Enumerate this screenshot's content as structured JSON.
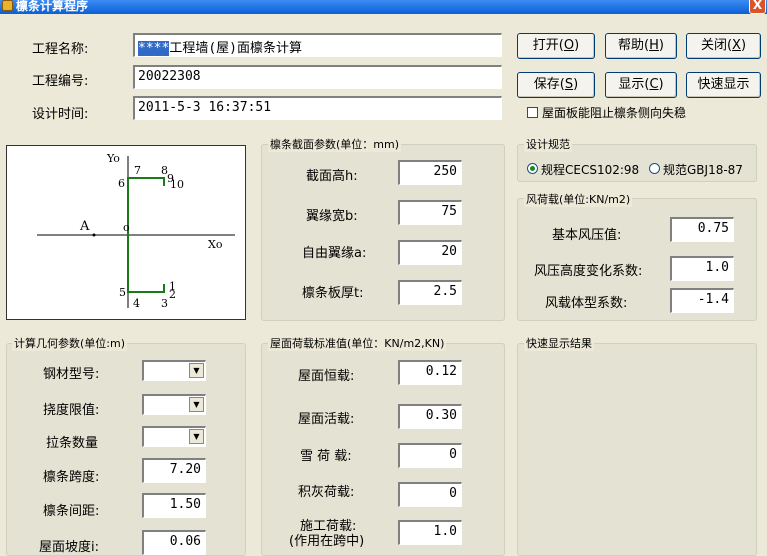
{
  "window": {
    "title": "檩条计算程序",
    "close": "X"
  },
  "project": {
    "name_label": "工程名称:",
    "name_value_selected": "****",
    "name_value_rest": "工程墙(屋)面檩条计算",
    "number_label": "工程编号:",
    "number_value": "20022308",
    "time_label": "设计时间:",
    "time_value": "2011-5-3 16:37:51"
  },
  "buttons": {
    "open": {
      "text": "打开(",
      "key": "O",
      "end": ")"
    },
    "help": {
      "text": "帮助(",
      "key": "H",
      "end": ")"
    },
    "close": {
      "text": "关闭(",
      "key": "X",
      "end": ")"
    },
    "save": {
      "text": "保存(",
      "key": "S",
      "end": ")"
    },
    "show": {
      "text": "显示(",
      "key": "C",
      "end": ")"
    },
    "quick": "快速显示"
  },
  "roof_checkbox": {
    "label": "屋面板能阻止檩条侧向失稳",
    "checked": false
  },
  "diagram": {
    "labels": {
      "y0": "Yo",
      "x0": "Xo",
      "a": "A",
      "o": "o",
      "n7": "7",
      "n8": "8",
      "n9": "9",
      "n10": "10",
      "n6": "6",
      "n5": "5",
      "n4": "4",
      "n3": "3",
      "n1": "1",
      "n2": "2"
    },
    "section_color": "#1A7A1A"
  },
  "section": {
    "title": "檩条截面参数(单位：mm)",
    "fields": [
      {
        "label": "截面高h:",
        "value": "250"
      },
      {
        "label": "翼缘宽b:",
        "value": "75"
      },
      {
        "label": "自由翼缘a:",
        "value": "20"
      },
      {
        "label": "檩条板厚t:",
        "value": "2.5"
      }
    ]
  },
  "code": {
    "title": "设计规范",
    "options": [
      {
        "label": "规程CECS102:98",
        "selected": true
      },
      {
        "label": "规范GBJ18-87",
        "selected": false
      }
    ]
  },
  "wind": {
    "title": "风荷载(单位:KN/m2)",
    "fields": [
      {
        "label": "基本风压值:",
        "value": "0.75"
      },
      {
        "label": "风压高度变化系数:",
        "value": "1.0"
      },
      {
        "label": "风载体型系数:",
        "value": "-1.4"
      }
    ]
  },
  "geometry": {
    "title": "计算几何参数(单位:m)",
    "combos": [
      {
        "label": "钢材型号:"
      },
      {
        "label": "挠度限值:"
      },
      {
        "label": "拉条数量"
      }
    ],
    "fields": [
      {
        "label": "檩条跨度:",
        "value": "7.20"
      },
      {
        "label": "檩条间距:",
        "value": "1.50"
      },
      {
        "label": "屋面坡度i:",
        "value": "0.06"
      }
    ]
  },
  "loads": {
    "title": "屋面荷载标准值(单位：KN/m2,KN)",
    "fields": [
      {
        "label": "屋面恒载:",
        "value": "0.12"
      },
      {
        "label": "屋面活载:",
        "value": "0.30"
      },
      {
        "label": "雪 荷 载:",
        "value": "0"
      },
      {
        "label": "积灰荷载:",
        "value": "0"
      },
      {
        "label": "施工荷载:",
        "label2": "(作用在跨中)",
        "value": "1.0"
      }
    ]
  },
  "quick_result": {
    "title": "快速显示结果"
  }
}
